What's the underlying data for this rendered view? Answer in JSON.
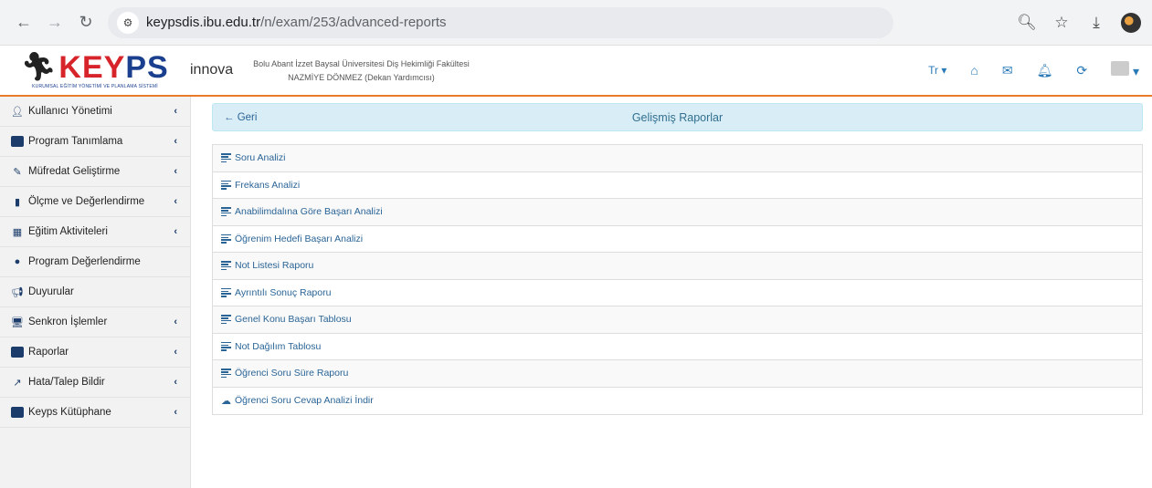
{
  "browser": {
    "url_host": "keypsdis.ibu.edu.tr",
    "url_path": "/n/exam/253/advanced-reports"
  },
  "header": {
    "logo_text_key": "KEY",
    "logo_text_ps": "PS",
    "logo_innova": "innova",
    "logo_subtitle": "KURUMSAL EĞİTİM YÖNETİMİ VE PLANLAMA SİSTEMİ",
    "faculty": "Bolu Abant İzzet Baysal Üniversitesi Diş Hekimliği Fakültesi",
    "user": "NAZMİYE DÖNMEZ (Dekan Yardımcısı)",
    "language": "Tr"
  },
  "sidebar": {
    "items": [
      {
        "label": "Kullanıcı Yönetimi"
      },
      {
        "label": "Program Tanımlama"
      },
      {
        "label": "Müfredat Geliştirme"
      },
      {
        "label": "Ölçme ve Değerlendirme"
      },
      {
        "label": "Eğitim Aktiviteleri"
      },
      {
        "label": "Program Değerlendirme"
      },
      {
        "label": "Duyurular"
      },
      {
        "label": "Senkron İşlemler"
      },
      {
        "label": "Raporlar"
      },
      {
        "label": "Hata/Talep Bildir"
      },
      {
        "label": "Keyps Kütüphane"
      }
    ]
  },
  "panel": {
    "back_label": "Geri",
    "title": "Gelişmiş Raporlar"
  },
  "reports": [
    "Soru Analizi",
    "Frekans Analizi",
    "Anabilimdalına Göre Başarı Analizi",
    "Öğrenim Hedefi Başarı Analizi",
    "Not Listesi Raporu",
    "Ayrıntılı Sonuç Raporu",
    "Genel Konu Başarı Tablosu",
    "Not Dağılım Tablosu",
    "Öğrenci Soru Süre Raporu",
    "Öğrenci Soru Cevap Analizi İndir"
  ],
  "colors": {
    "accent_orange": "#e97a2a",
    "brand_red": "#d6242a",
    "brand_blue": "#1b3f8f",
    "link_blue": "#2a6496",
    "panel_bg": "#d9edf7"
  }
}
